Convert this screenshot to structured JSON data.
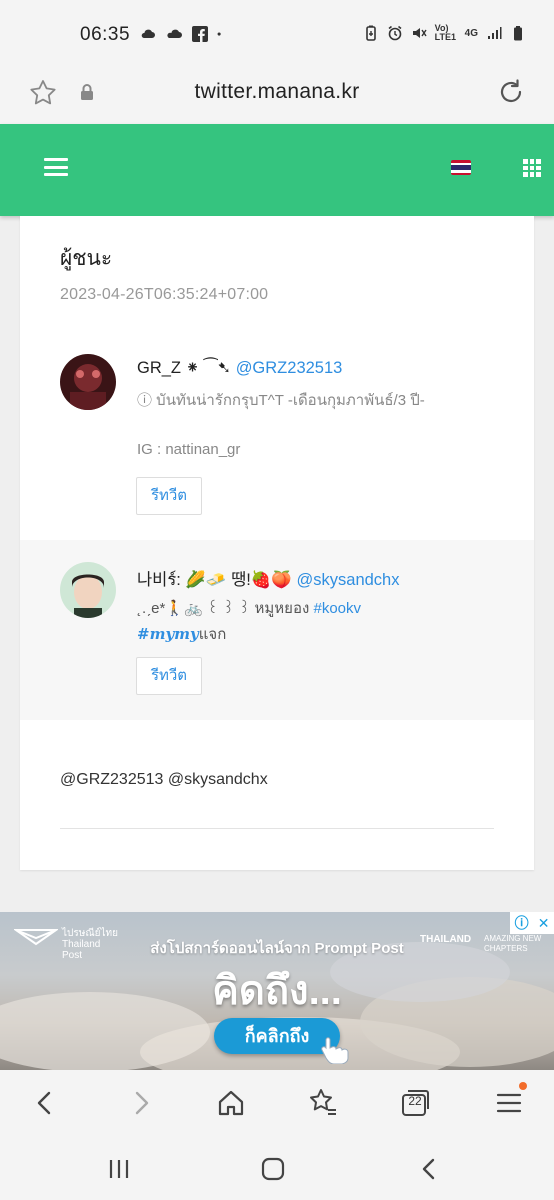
{
  "status_bar": {
    "time": "06:35",
    "network_label": "Vo) LTE1",
    "network_type": "4G"
  },
  "browser": {
    "url": "twitter.manana.kr",
    "tab_count": "22"
  },
  "app_bar": {
    "accent_color": "#35c47f",
    "flag": "thailand-flag-icon"
  },
  "post": {
    "title": "ผู้ชนะ",
    "date": "2023-04-26T06:35:24+07:00",
    "mentions": "@GRZ232513 @skysandchx"
  },
  "tweets": [
    {
      "name": "GR_Z ⁕ ⁀➷",
      "handle": "@GRZ232513",
      "bio_line1": "ⓘ บันทันน่ารักกรุบT^T -เดือนกุมภาพันธ์/3 ปี-",
      "bio_line2": "IG : nattinan_gr",
      "retweet_label": "รีทวีต"
    },
    {
      "name": "나비ร์: 🌽🧈 땡!🍓🍑",
      "handle": "@skysandchx",
      "bio_line1_prefix": "˛.ˏe*🚶🚲 ꒰ ꒱ ꒱ หมูหยอง ",
      "bio_line1_hashtag": "#kookv",
      "bio_line2_hashtag": "#𝒎𝒚𝒎𝒚",
      "bio_line2_suffix": "แจก",
      "retweet_label": "รีทวีต"
    }
  ],
  "ad": {
    "brand": "ไปรษณีย์ไทย Thailand Post",
    "headline": "ส่งโปสการ์ดออนไลน์จาก Prompt Post",
    "big_text": "คิดถึง...",
    "cta": "ก็คลิกถึง",
    "partner": "THAILAND",
    "partner_tagline": "AMAZING NEW CHAPTERS"
  },
  "colors": {
    "link": "#2f8ee0",
    "muted": "#999999",
    "badge": "#f26c2a"
  }
}
